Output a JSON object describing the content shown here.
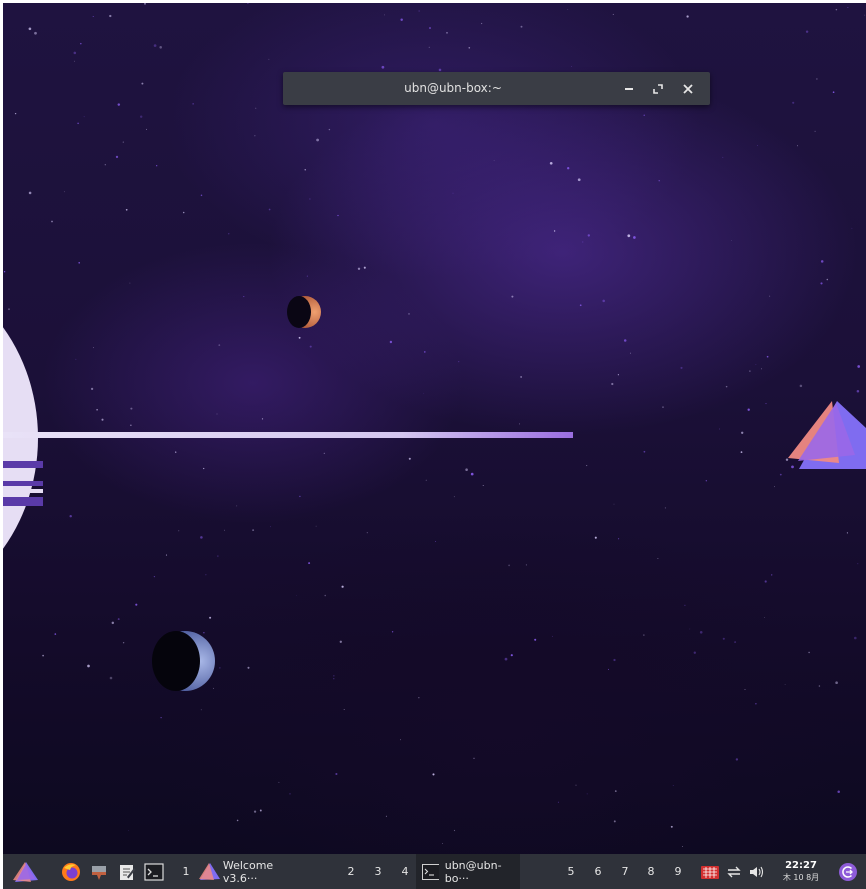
{
  "terminal_window": {
    "title": "ubn@ubn-box:~",
    "minimize_icon": "minimize-icon",
    "maximize_icon": "maximize-icon",
    "close_icon": "close-icon"
  },
  "taskbar": {
    "launchers": [
      {
        "name": "firefox",
        "icon": "firefox-icon"
      },
      {
        "name": "files",
        "icon": "file-manager-icon"
      },
      {
        "name": "text-editor",
        "icon": "text-editor-icon"
      },
      {
        "name": "terminal",
        "icon": "terminal-icon"
      }
    ],
    "workspaces_left": [
      "1"
    ],
    "welcome_task_label": "Welcome v3.6···",
    "workspaces_mid": [
      "2",
      "3",
      "4"
    ],
    "terminal_task_label": "ubn@ubn-bo···",
    "workspaces_right": [
      "5",
      "6",
      "7",
      "8",
      "9"
    ],
    "clock_time": "22:27",
    "clock_date": "木 10 8月"
  },
  "colors": {
    "taskbar_bg": "#2f323a",
    "titlebar_bg": "#3a3d45",
    "accent_purple": "#8e5cd9"
  }
}
